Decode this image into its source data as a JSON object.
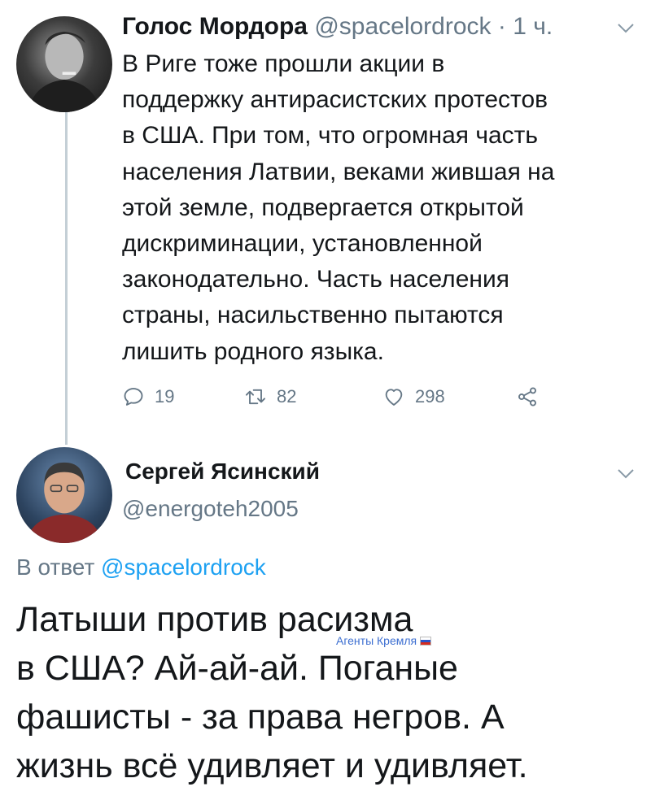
{
  "tweet1": {
    "display_name": "Голос Мордора",
    "handle": "@spacelordrock",
    "separator": "·",
    "time": "1 ч.",
    "text": "В Риге тоже прошли акции в\nподдержку антирасистских протестов\nв США. При том, что огромная часть\nнаселения Латвии, веками жившая на\nэтой земле, подвергается открытой\nдискриминации, установленной\nзаконодательно. Часть населения\nстраны, насильственно пытаются\nлишить родного языка.",
    "actions": {
      "replies": "19",
      "retweets": "82",
      "likes": "298"
    }
  },
  "tweet2": {
    "display_name": "Сергей Ясинский",
    "handle": "@energoteh2005",
    "reply_prefix": "В ответ",
    "reply_handle": "@spacelordrock",
    "text": "Латыши против расизма\nв США? Ай-ай-ай. Поганые\nфашисты - за права негров. А\nжизнь всё удивляет и удивляет."
  },
  "watermark": {
    "text": "Агенты Кремля"
  },
  "icons": {
    "reply": "reply-icon",
    "retweet": "retweet-icon",
    "like": "heart-icon",
    "share": "share-icon",
    "menu": "chevron-down-icon"
  },
  "colors": {
    "text_primary": "#14171a",
    "text_secondary": "#657786",
    "link": "#1da1f2",
    "thread_line": "#c4cfd6"
  }
}
